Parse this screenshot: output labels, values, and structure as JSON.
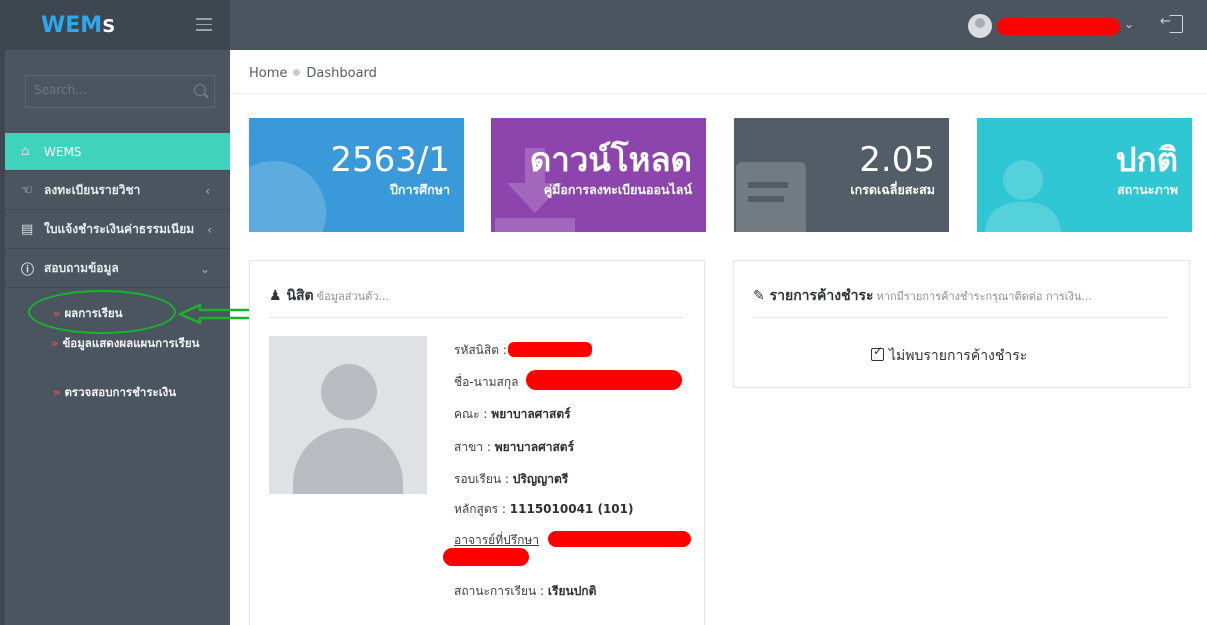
{
  "brand": {
    "logo_main": "WEM",
    "logo_end": "S"
  },
  "sidebar": {
    "search_placeholder": "Search...",
    "items": [
      {
        "label": "WEMS",
        "icon": "home-icon"
      },
      {
        "label": "ลงทะเบียนรายวิชา",
        "icon": "hand-icon"
      },
      {
        "label": "ใบแจ้งชำระเงินค่าธรรมเนียม",
        "icon": "document-icon"
      },
      {
        "label": "สอบถามข้อมูล",
        "icon": "info-icon"
      }
    ],
    "sub_items": [
      {
        "label": "ผลการเรียน"
      },
      {
        "label": "ข้อมูลแสดงผลแผนการเรียน"
      },
      {
        "label": "ตรวจสอบการชำระเงิน"
      }
    ]
  },
  "breadcrumb": {
    "home": "Home",
    "current": "Dashboard"
  },
  "tiles": [
    {
      "big": "2563/1",
      "small": "ปีการศึกษา",
      "color": "#3a9ad9"
    },
    {
      "big": "ดาวน์โหลด",
      "small": "คู่มือการลงทะเบียนออนไลน์",
      "color": "#8e44ad"
    },
    {
      "big": "2.05",
      "small": "เกรดเฉลี่ยสะสม",
      "color": "#535d67"
    },
    {
      "big": "ปกติ",
      "small": "สถานะภาพ",
      "color": "#2ec7d3"
    }
  ],
  "student_panel": {
    "title": "นิสิต",
    "subtitle": "ข้อมูลส่วนตัว...",
    "fields": {
      "student_id_label": "รหัสนิสิต :",
      "name_label": "ชื่อ-นามสกุล",
      "faculty_label": "คณะ :",
      "faculty_value": "พยาบาลศาสตร์",
      "major_label": "สาขา :",
      "major_value": "พยาบาลศาสตร์",
      "round_label": "รอบเรียน :",
      "round_value": "ปริญญาตรี",
      "curriculum_label": "หลักสูตร :",
      "curriculum_value": "1115010041 (101)",
      "advisor_label": "อาจารย์ที่ปรึกษา",
      "status_label": "สถานะการเรียน :",
      "status_value": "เรียนปกติ"
    }
  },
  "dues_panel": {
    "title": "รายการค้างชำระ",
    "subtitle": "หากมีรายการค้างชำระกรุณาติดต่อ การเงิน...",
    "message": "ไม่พบรายการค้างชำระ"
  }
}
